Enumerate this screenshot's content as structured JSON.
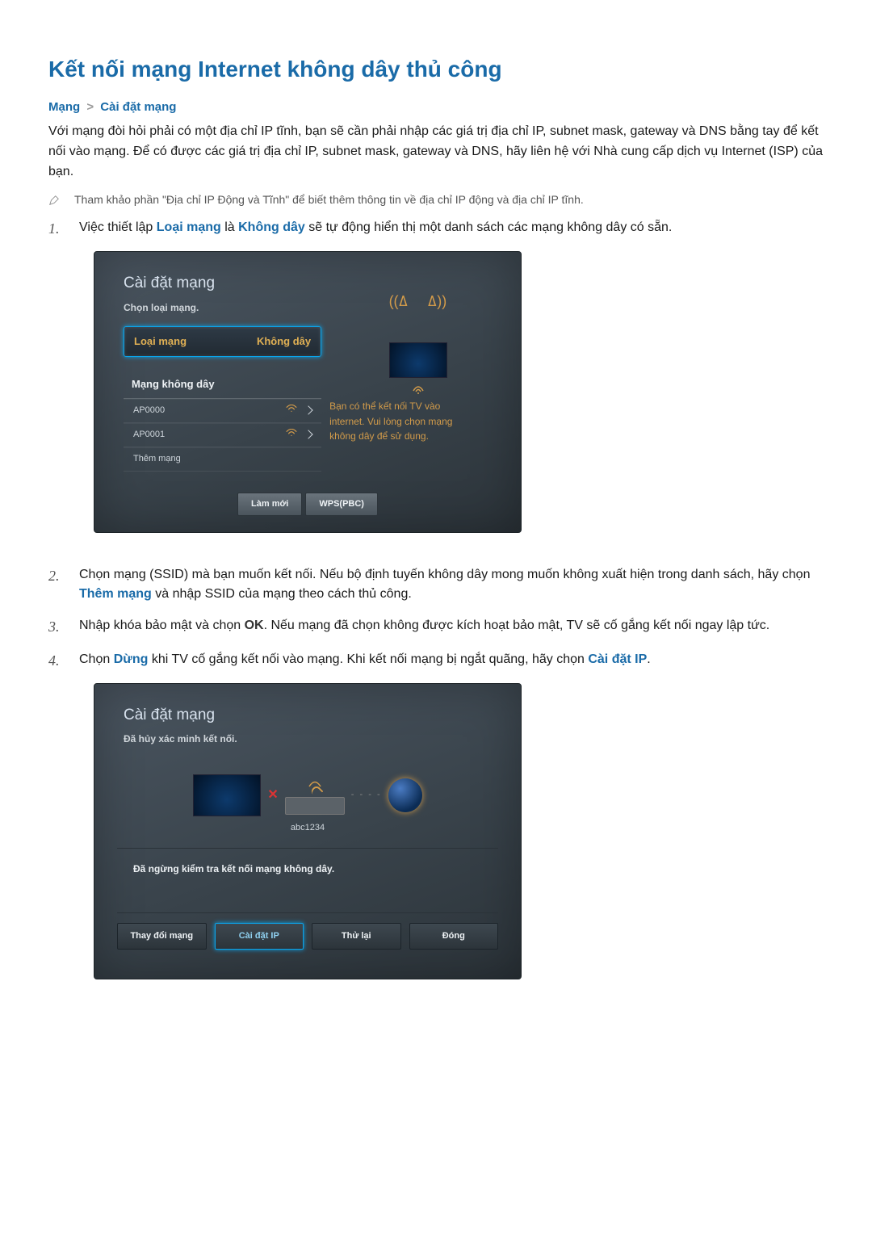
{
  "title": "Kết nối mạng Internet không dây thủ công",
  "breadcrumb": {
    "a": "Mạng",
    "sep": ">",
    "b": "Cài đặt mạng"
  },
  "intro": "Với mạng đòi hỏi phải có một địa chỉ IP tĩnh, bạn sẽ cần phải nhập các giá trị địa chỉ IP, subnet mask, gateway và DNS bằng tay để kết nối vào mạng. Để có được các giá trị địa chỉ IP, subnet mask, gateway và DNS, hãy liên hệ với Nhà cung cấp dịch vụ Internet (ISP) của bạn.",
  "note": "Tham khảo phần \"Địa chỉ IP Động và Tĩnh\" để biết thêm thông tin về địa chỉ IP động và địa chỉ IP tĩnh.",
  "steps": {
    "1": {
      "num": "1.",
      "pre": "Việc thiết lập ",
      "kw1": "Loại mạng",
      "mid": " là ",
      "kw2": "Không dây",
      "post": " sẽ tự động hiển thị một danh sách các mạng không dây có sẵn."
    },
    "2": {
      "num": "2.",
      "pre": "Chọn mạng (SSID) mà bạn muốn kết nối. Nếu bộ định tuyến không dây mong muốn không xuất hiện trong danh sách, hãy chọn ",
      "kw1": "Thêm mạng",
      "post": " và nhập SSID của mạng theo cách thủ công."
    },
    "3": {
      "num": "3.",
      "pre": "Nhập khóa bảo mật và chọn ",
      "kw1": "OK",
      "post": ". Nếu mạng đã chọn không được kích hoạt bảo mật, TV sẽ cố gắng kết nối ngay lập tức."
    },
    "4": {
      "num": "4.",
      "pre": "Chọn ",
      "kw1": "Dừng",
      "mid": " khi TV cố gắng kết nối vào mạng. Khi kết nối mạng bị ngắt quãng, hãy chọn ",
      "kw2": "Cài đặt IP",
      "post": "."
    }
  },
  "panel1": {
    "title": "Cài đặt mạng",
    "sub": "Chọn loại mạng.",
    "sel_label": "Loại mạng",
    "sel_value": "Không dây",
    "section": "Mạng không dây",
    "ap0": "AP0000",
    "ap1": "AP0001",
    "addnet": "Thêm mạng",
    "help1": "Bạn có thể kết nối TV vào",
    "help2": "internet. Vui lòng chọn mạng",
    "help3": "không dây để sử dụng.",
    "btn_refresh": "Làm mới",
    "btn_wps": "WPS(PBC)"
  },
  "panel2": {
    "title": "Cài đặt mạng",
    "sub": "Đã hủy xác minh kết nối.",
    "ap_label": "abc1234",
    "msg": "Đã ngừng kiểm tra kết nối mạng không dây.",
    "btn_change": "Thay đổi mạng",
    "btn_ip": "Cài đặt IP",
    "btn_retry": "Thử lại",
    "btn_close": "Đóng"
  }
}
